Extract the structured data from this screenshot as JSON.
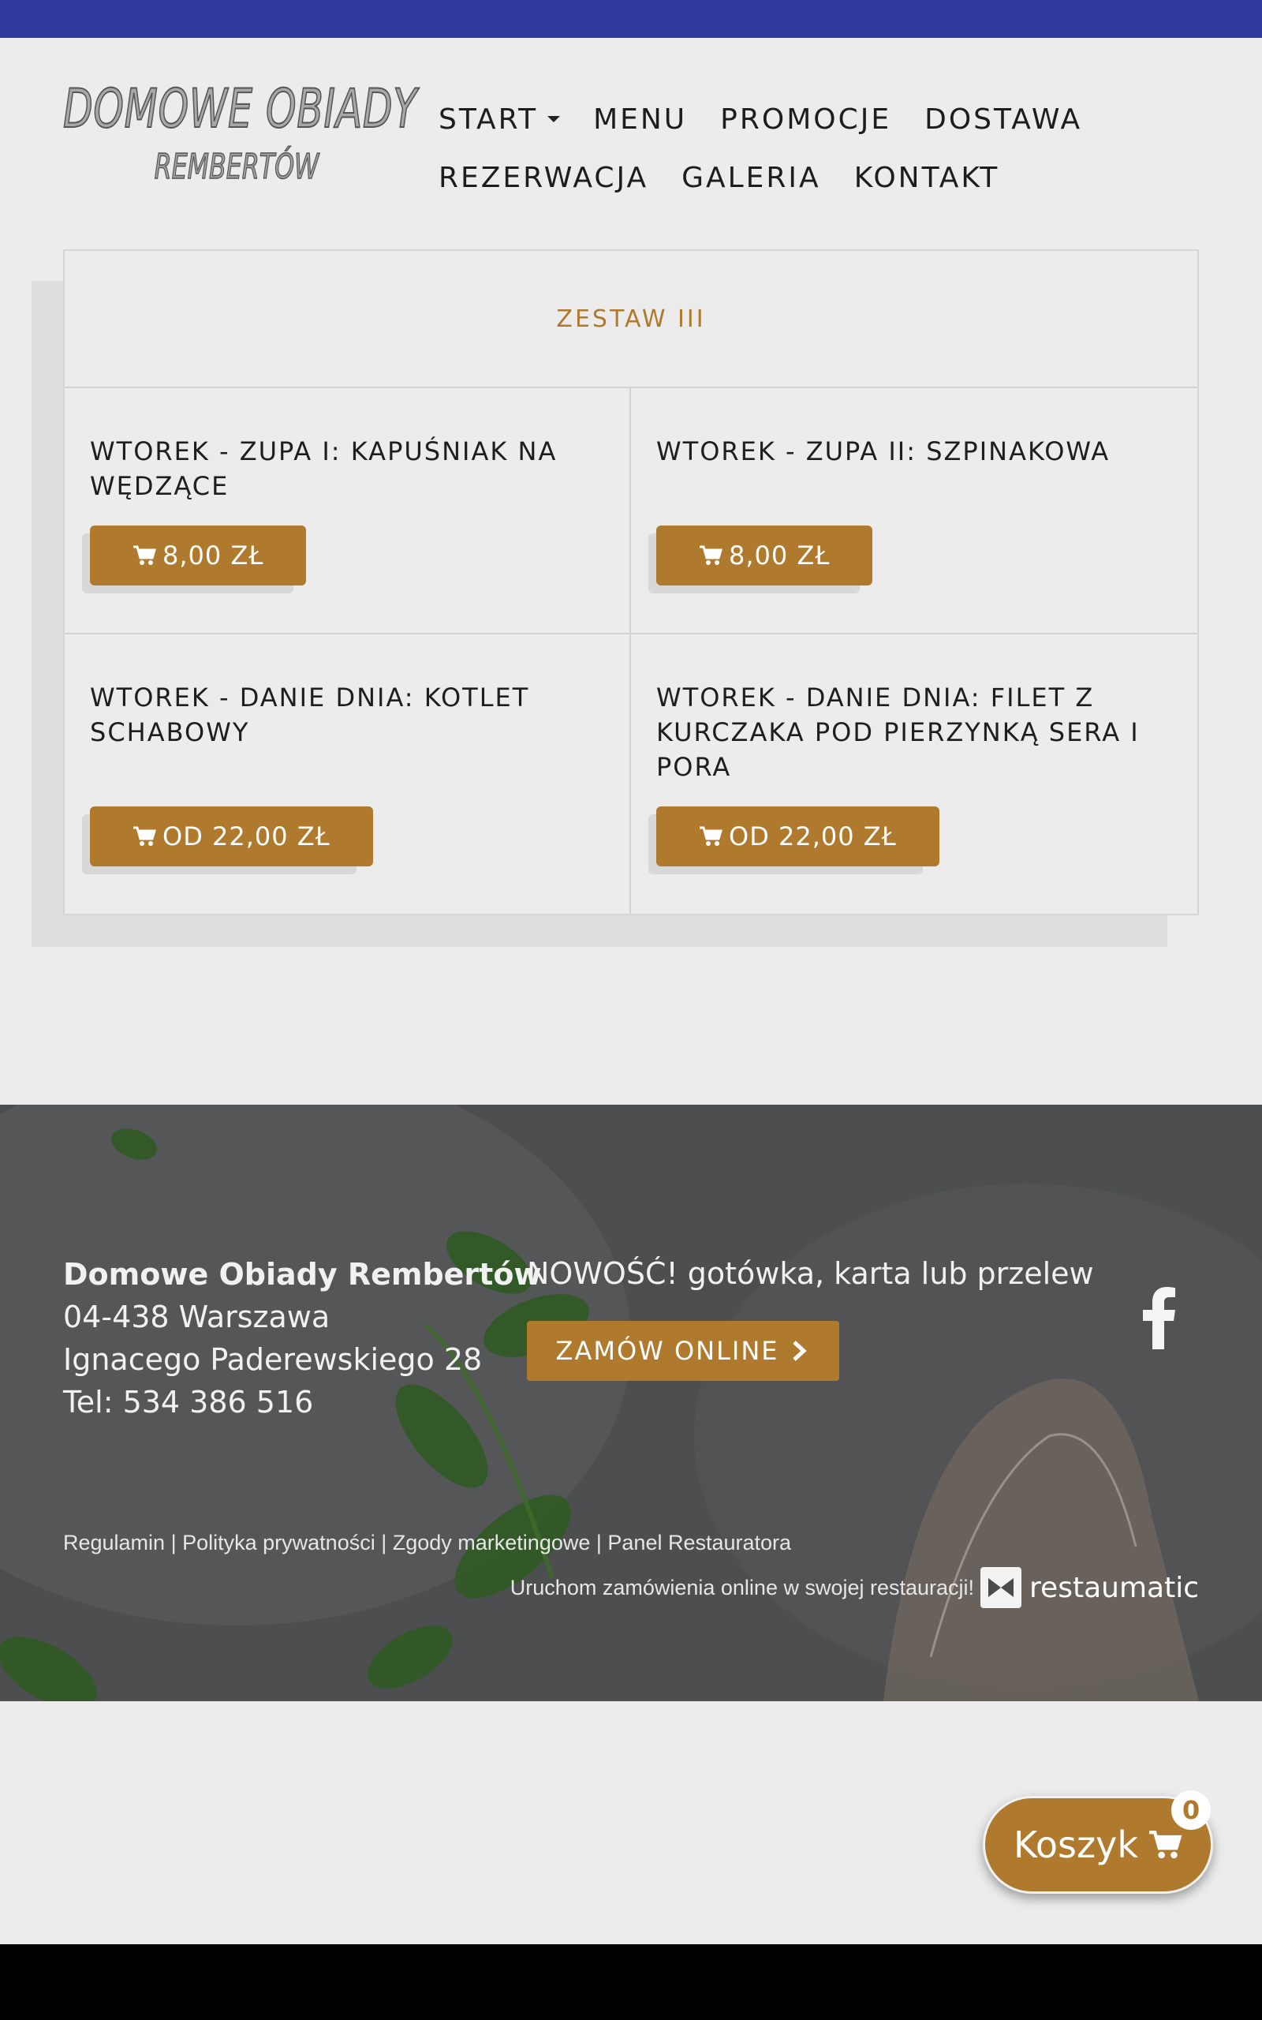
{
  "logo": {
    "line1": "DOMOWE OBIADY",
    "line2": "REMBERTÓW"
  },
  "nav": {
    "row1": [
      {
        "label": "START",
        "has_dropdown": true
      },
      {
        "label": "MENU"
      },
      {
        "label": "PROMOCJE"
      },
      {
        "label": "DOSTAWA"
      }
    ],
    "row2": [
      {
        "label": "REZERWACJA"
      },
      {
        "label": "GALERIA"
      },
      {
        "label": "KONTAKT"
      }
    ]
  },
  "menu_section": {
    "title": "ZESTAW III",
    "items": [
      {
        "name": "WTOREK - ZUPA I: KAPUŚNIAK NA WĘDZĄCE",
        "price": "8,00 ZŁ"
      },
      {
        "name": "WTOREK - ZUPA II: SZPINAKOWA",
        "price": "8,00 ZŁ"
      },
      {
        "name": "WTOREK - DANIE DNIA: KOTLET SCHABOWY",
        "price": "OD 22,00 ZŁ"
      },
      {
        "name": "WTOREK - DANIE DNIA: FILET Z KURCZAKA POD PIERZYNKĄ SERA I PORA",
        "price": "OD 22,00 ZŁ"
      }
    ]
  },
  "footer": {
    "name": "Domowe Obiady Rembertów",
    "city": "04-438 Warszawa",
    "street": "Ignacego Paderewskiego 28",
    "phone": "Tel: 534 386 516",
    "promo": "NOWOŚĆ! gotówka, karta lub przelew",
    "order_button": "ZAMÓW ONLINE",
    "links": [
      "Regulamin",
      "Polityka prywatności",
      "Zgody marketingowe",
      "Panel Restauratora"
    ],
    "powered_text": "Uruchom zamówienia online w swojej restauracji!",
    "powered_brand": "restaumatic"
  },
  "cart": {
    "label": "Koszyk",
    "count": "0"
  },
  "colors": {
    "accent": "#b07a2e",
    "topbar": "#2f3a9e",
    "background": "#ececec"
  },
  "icons": [
    "cart-icon",
    "caret-down-icon",
    "chevron-right-icon",
    "facebook-icon",
    "restaumatic-logo-icon"
  ]
}
